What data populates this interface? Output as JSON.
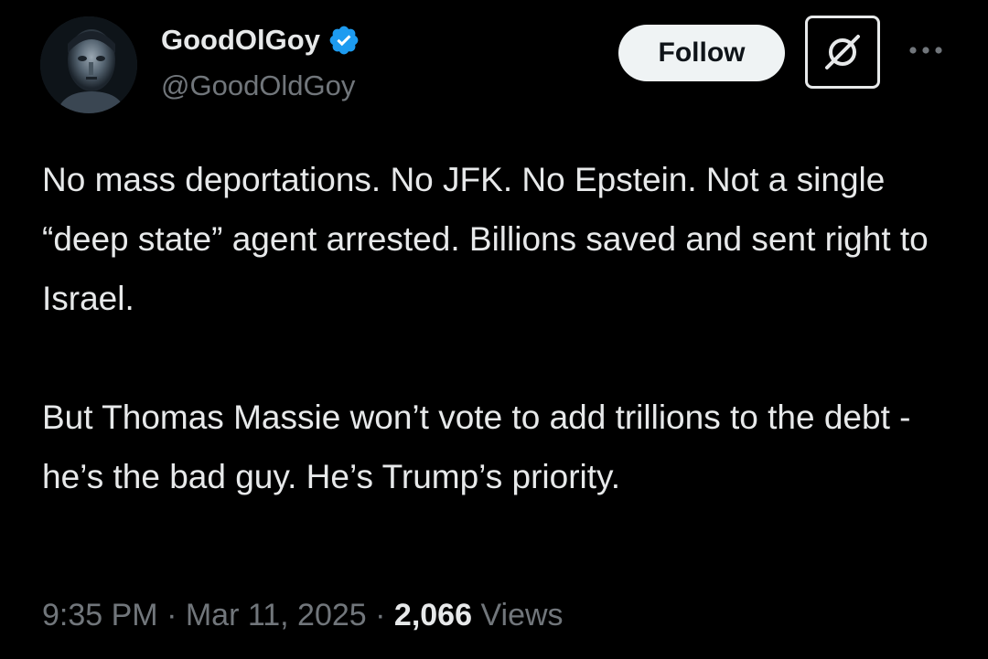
{
  "author": {
    "display_name": "GoodOlGoy",
    "handle": "@GoodOldGoy",
    "verified": true
  },
  "actions": {
    "follow_label": "Follow"
  },
  "tweet": {
    "paragraphs": [
      "No mass deportations. No JFK. No Epstein. Not a single “deep state” agent arrested. Billions saved and sent right to Israel.",
      "But Thomas Massie won’t vote to add trillions to the debt - he’s the bad guy. He’s Trump’s priority."
    ],
    "time": "9:35 PM",
    "separator": "·",
    "date": "Mar 11, 2025",
    "views_count": "2,066",
    "views_label": "Views"
  },
  "colors": {
    "background": "#000000",
    "text_primary": "#e7e9ea",
    "text_secondary": "#71767b",
    "verified_badge": "#1d9bf0",
    "follow_button_bg": "#eff3f4"
  },
  "icons": {
    "verified": "verified-badge-icon",
    "grok": "grok-icon",
    "more": "more-horizontal-icon"
  }
}
